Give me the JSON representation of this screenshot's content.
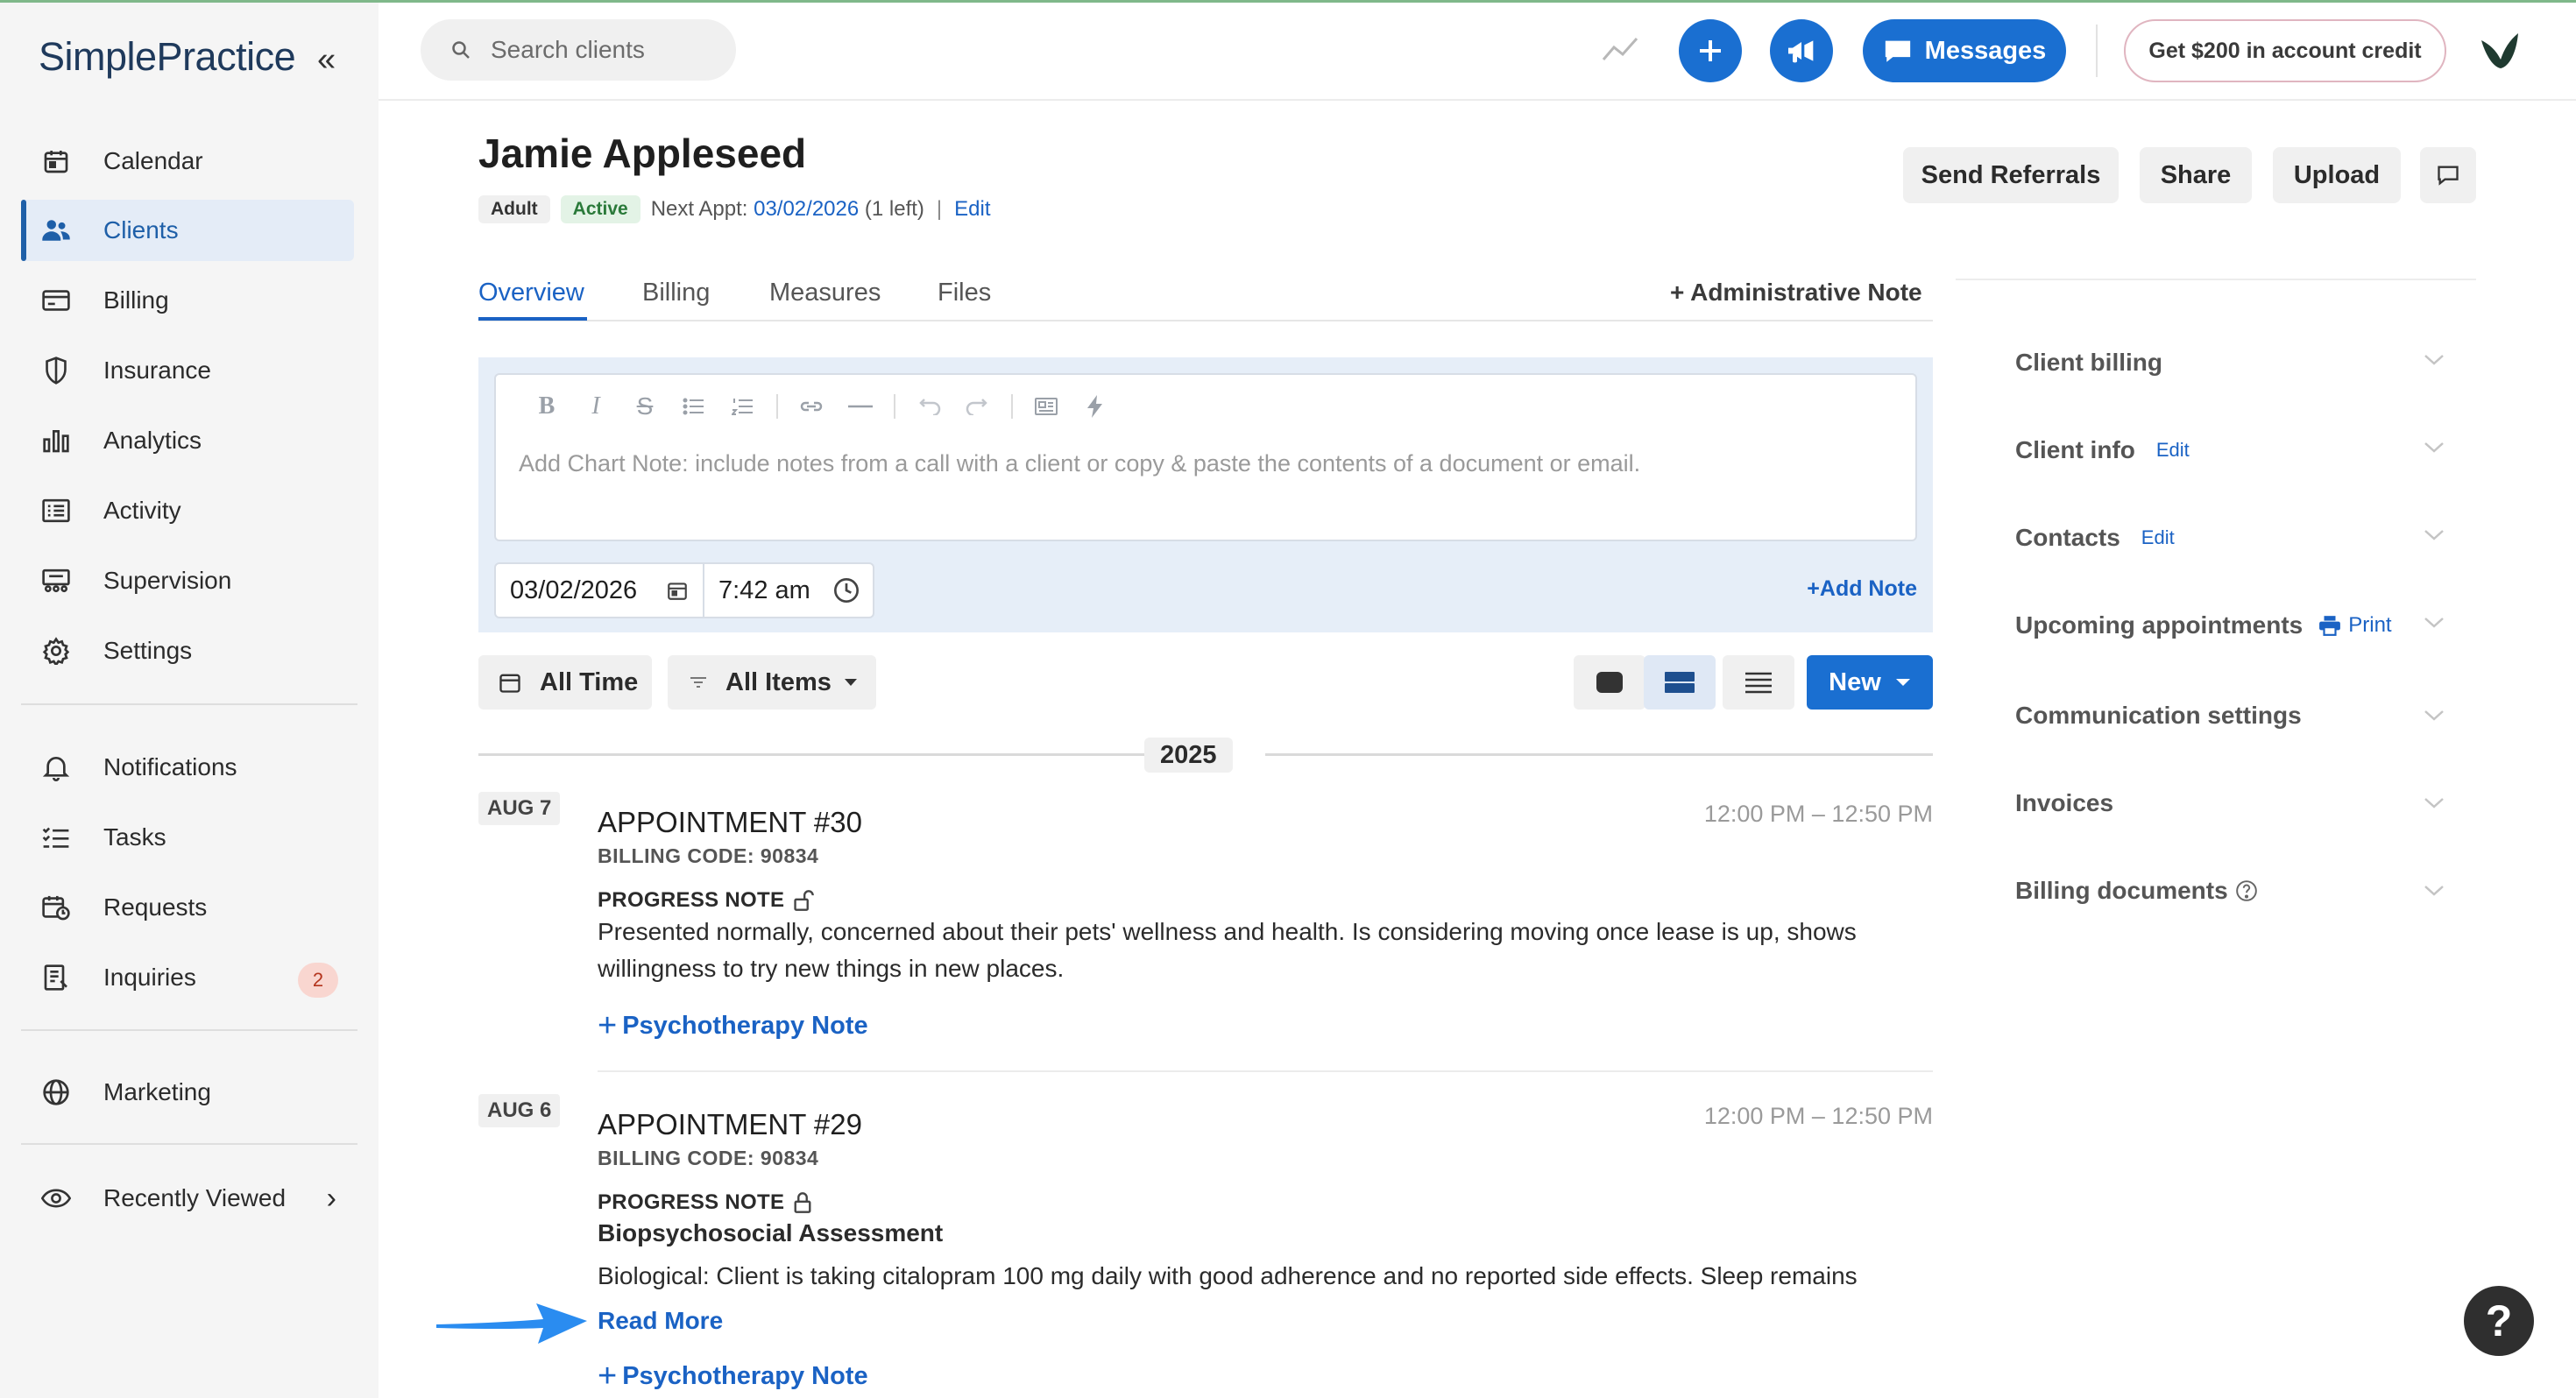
{
  "app": {
    "logo": "SimplePractice"
  },
  "sidebar": {
    "items": [
      {
        "label": "Calendar",
        "icon": "calendar-icon"
      },
      {
        "label": "Clients",
        "icon": "users-icon"
      },
      {
        "label": "Billing",
        "icon": "credit-card-icon"
      },
      {
        "label": "Insurance",
        "icon": "shield-icon"
      },
      {
        "label": "Analytics",
        "icon": "bar-chart-icon"
      },
      {
        "label": "Activity",
        "icon": "list-icon"
      },
      {
        "label": "Supervision",
        "icon": "supervision-icon"
      },
      {
        "label": "Settings",
        "icon": "gear-icon"
      }
    ],
    "secondary": [
      {
        "label": "Notifications",
        "icon": "bell-icon"
      },
      {
        "label": "Tasks",
        "icon": "checklist-icon"
      },
      {
        "label": "Requests",
        "icon": "calendar-clock-icon"
      },
      {
        "label": "Inquiries",
        "icon": "inquiry-icon",
        "badge": "2"
      }
    ],
    "marketing": {
      "label": "Marketing",
      "icon": "globe-icon"
    },
    "recently_viewed": {
      "label": "Recently Viewed",
      "icon": "eye-icon"
    }
  },
  "topbar": {
    "search_placeholder": "Search clients",
    "messages_label": "Messages",
    "credit_label": "Get $200 in account credit"
  },
  "client": {
    "name": "Jamie Appleseed",
    "tag_type": "Adult",
    "tag_status": "Active",
    "next_appt_label": "Next Appt:",
    "next_appt_date": "03/02/2026",
    "next_appt_left": "(1 left)",
    "edit_label": "Edit"
  },
  "header_buttons": {
    "send_referrals": "Send Referrals",
    "share": "Share",
    "upload": "Upload"
  },
  "tabs": [
    {
      "label": "Overview",
      "selected": true
    },
    {
      "label": "Billing",
      "selected": false
    },
    {
      "label": "Measures",
      "selected": false
    },
    {
      "label": "Files",
      "selected": false
    }
  ],
  "admin_note_label": "+ Administrative Note",
  "editor": {
    "placeholder": "Add Chart Note: include notes from a call with a client or copy & paste the contents of a document or email.",
    "date": "03/02/2026",
    "time": "7:42 am",
    "add_note_label": "Add Note"
  },
  "filters": {
    "time_label": "All Time",
    "items_label": "All Items",
    "new_label": "New"
  },
  "timeline": {
    "year": "2025",
    "entries": [
      {
        "date": "AUG 7",
        "title": "APPOINTMENT #30",
        "time": "12:00 PM – 12:50 PM",
        "billing_code": "BILLING CODE: 90834",
        "note_type": "PROGRESS NOTE",
        "body": "Presented normally, concerned about their pets' wellness and health. Is considering moving once lease is up, shows willingness to try new things in new places.",
        "add_label": "Psychotherapy Note"
      },
      {
        "date": "AUG 6",
        "title": "APPOINTMENT #29",
        "time": "12:00 PM – 12:50 PM",
        "billing_code": "BILLING CODE: 90834",
        "note_type": "PROGRESS NOTE",
        "subtitle": "Biopsychosocial Assessment",
        "body": "Biological: Client is taking citalopram 100 mg daily with good adherence and no reported side effects. Sleep remains",
        "read_more": "Read More",
        "add_label": "Psychotherapy Note"
      }
    ]
  },
  "right_panel": {
    "sections": [
      {
        "label": "Client billing"
      },
      {
        "label": "Client info",
        "edit": "Edit"
      },
      {
        "label": "Contacts",
        "edit": "Edit"
      },
      {
        "label": "Upcoming appointments",
        "print": "Print"
      },
      {
        "label": "Communication settings"
      },
      {
        "label": "Invoices"
      },
      {
        "label": "Billing documents"
      }
    ]
  },
  "colors": {
    "brand_blue": "#1a6fd1",
    "link_blue": "#1a62c4",
    "active_bg": "#e4ecf7"
  }
}
